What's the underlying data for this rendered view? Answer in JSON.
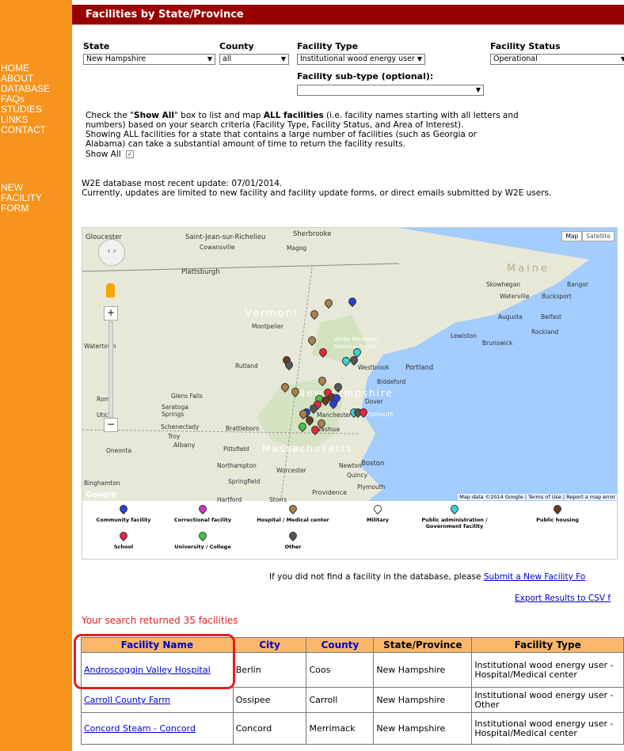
{
  "nav": {
    "items": [
      "HOME",
      "ABOUT",
      "DATABASE",
      "FAQs",
      "STUDIES",
      "LINKS",
      "CONTACT"
    ],
    "new_facility": [
      "NEW",
      "FACILITY",
      "FORM"
    ]
  },
  "header": {
    "title": "Facilities by State/Province"
  },
  "filters": {
    "state_label": "State",
    "state_value": "New Hampshire",
    "county_label": "County",
    "county_value": "all",
    "type_label": "Facility Type",
    "type_value": "Institutional wood energy user",
    "status_label": "Facility Status",
    "status_value": "Operational",
    "subtype_label": "Facility sub-type (optional):",
    "subtype_value": ""
  },
  "instructions": {
    "line1_a": "Check the \"",
    "line1_bold1": "Show All",
    "line1_b": "\" box to list and map ",
    "line1_bold2": "ALL facilities",
    "line1_c": " (i.e. facility names starting with all letters and",
    "line2": "numbers) based on your search criteria (Facility Type, Facility Status, and Area of Interest).",
    "line3": "Showing ALL facilities for a state that contains a large number of facilities (such as Georgia or",
    "line4": "Alabama) can take a substantial amount of time to return the facility results.",
    "show_all": "Show All"
  },
  "update": {
    "line1": "W2E database most recent update: 07/01/2014.",
    "line2": "Currently, updates are limited to new facility and facility update forms, or direct emails submitted by W2E users."
  },
  "map": {
    "map_btn": "Map",
    "sat_btn": "Satellite",
    "places": [
      "Gloucester",
      "Saint-Jean-sur-Richelieu",
      "Sherbrooke",
      "Cowansville",
      "Magog",
      "Maine",
      "Plattsburgh",
      "Skowhegan",
      "Bangor",
      "Waterville",
      "Bucksport",
      "Vermont",
      "Augusta",
      "Belfast",
      "Montpelier",
      "Lewiston",
      "Rockland",
      "Watertown",
      "White Mountain National Forest",
      "Brunswick",
      "Rutland",
      "Westbrook",
      "Portland",
      "Biddeford",
      "Glens Falls",
      "Rome",
      "Saratoga Springs",
      "Dover",
      "Utica",
      "Manchester",
      "Portsmouth",
      "Schenectady",
      "Brattleboro",
      "Nashua",
      "Troy",
      "Albany",
      "Pittsfield",
      "Massachusetts",
      "Oneonta",
      "Northampton",
      "Newton",
      "Boston",
      "Worcester",
      "Quincy",
      "Springfield",
      "Binghamton",
      "Plymouth",
      "Providence",
      "Hartford",
      "Storrs",
      "New Hampshire"
    ],
    "copyright": "Map data ©2014 Google",
    "terms": "Terms of Use",
    "report": "Report a map error",
    "google": "Google"
  },
  "legend": [
    {
      "label": "Community facility",
      "color": "#2b3fd6"
    },
    {
      "label": "Correctional facility",
      "color": "#cc33cc"
    },
    {
      "label": "Hospital / Medical center",
      "color": "#a9804e"
    },
    {
      "label": "Military",
      "color": "#ffffff"
    },
    {
      "label": "Public administration / Government facility",
      "color": "#39d3d3"
    },
    {
      "label": "Public housing",
      "color": "#6b3a1a"
    },
    {
      "label": "School",
      "color": "#e8283a"
    },
    {
      "label": "University / College",
      "color": "#45c445"
    },
    {
      "label": "Other",
      "color": "#555555"
    }
  ],
  "submit": {
    "prefix": "If you did not find a facility in the database, please ",
    "link": "Submit a New Facility Fo",
    "export": "Export Results to CSV f"
  },
  "results": {
    "summary": "Your search returned 35 facilities",
    "headers": [
      "Facility Name",
      "City",
      "County",
      "State/Province",
      "Facility Type"
    ],
    "rows": [
      {
        "name": "Androscoggin Valley Hospital",
        "city": "Berlin",
        "county": "Coos",
        "state": "New Hampshire",
        "type": "Institutional wood energy user - Hospital/Medical center"
      },
      {
        "name": "Carroll County Farm",
        "city": "Ossipee",
        "county": "Carroll",
        "state": "New Hampshire",
        "type": "Institutional wood energy user - Other"
      },
      {
        "name": "Concord Steam - Concord",
        "city": "Concord",
        "county": "Merrimack",
        "state": "New Hampshire",
        "type": "Institutional wood energy user - Hospital/Medical center"
      }
    ]
  }
}
